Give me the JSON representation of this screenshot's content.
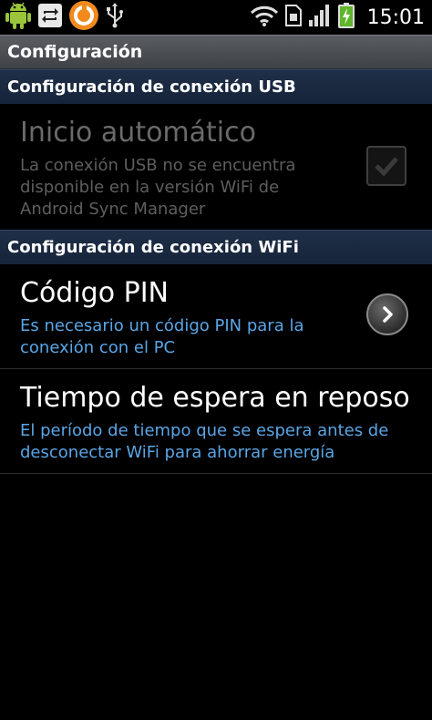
{
  "status_bar": {
    "time": "15:01",
    "icons": [
      "android-icon",
      "sync-icon",
      "orange-app-icon",
      "usb-icon",
      "wifi-icon",
      "sim-icon",
      "signal-icon",
      "battery-charging-icon"
    ]
  },
  "title_bar": {
    "title": "Configuración"
  },
  "sections": {
    "usb_header": "Configuración de conexión USB",
    "wifi_header": "Configuración de conexión WiFi"
  },
  "items": {
    "auto_start": {
      "title": "Inicio automático",
      "summary_line1": "La conexión USB no se encuentra",
      "summary_line2": "disponible en la versión WiFi de",
      "summary_line3": "Android Sync Manager",
      "checked": true,
      "enabled": false
    },
    "pin_code": {
      "title": "Código PIN",
      "summary_line1": "Es necesario un código PIN para la",
      "summary_line2": "conexión con el PC"
    },
    "sleep_timeout": {
      "title": "Tiempo de espera en reposo",
      "summary_line1": "El período de tiempo que se espera antes de",
      "summary_line2": "desconectar WiFi para ahorrar energía"
    }
  },
  "colors": {
    "background": "#000000",
    "accent_summary": "#5aa6e6",
    "disabled_text": "#6a6a6a",
    "section_header": "#1f2f47"
  }
}
